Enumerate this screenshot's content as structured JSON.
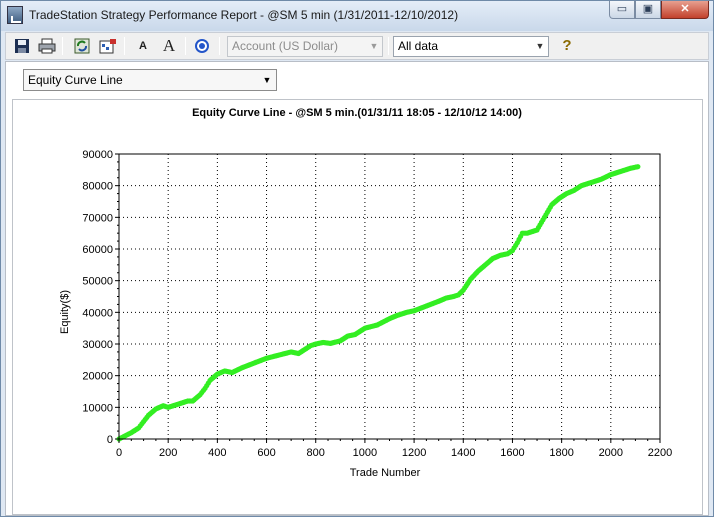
{
  "window": {
    "title": "TradeStation Strategy Performance Report - @SM 5 min (1/31/2011-12/10/2012)",
    "minimize_glyph": "▭",
    "maximize_glyph": "▣",
    "close_glyph": "✕"
  },
  "toolbar": {
    "save_icon": "save-icon",
    "print_icon": "print-icon",
    "refresh_icon": "refresh-icon",
    "settings_icon": "settings-icon",
    "font_small_label": "A",
    "font_large_label": "A",
    "target_icon": "target-icon",
    "account_combo": "Account (US Dollar)",
    "period_combo": "All data",
    "help_label": "?"
  },
  "view_selector": "Equity Curve Line",
  "chart_data": {
    "type": "line",
    "title": "Equity Curve Line - @SM 5 min.(01/31/11 18:05 - 12/10/12 14:00)",
    "xlabel": "Trade Number",
    "ylabel": "Equity($)",
    "xlim": [
      0,
      2200
    ],
    "ylim": [
      0,
      90000
    ],
    "x_ticks": [
      "0",
      "200",
      "400",
      "600",
      "800",
      "1000",
      "1200",
      "1400",
      "1600",
      "1800",
      "2000",
      "2200"
    ],
    "y_ticks": [
      "0",
      "10000",
      "20000",
      "30000",
      "40000",
      "50000",
      "60000",
      "70000",
      "80000",
      "90000"
    ],
    "grid": true,
    "series_color": "#33ee22",
    "drawdown_color": "#000000",
    "series": [
      {
        "x": [
          0,
          20,
          50,
          80,
          100,
          120,
          150,
          180,
          200,
          240,
          280,
          300,
          330,
          350,
          370,
          400,
          430,
          460,
          500,
          550,
          600,
          650,
          700,
          730,
          760,
          780,
          800,
          830,
          860,
          900,
          930,
          960,
          1000,
          1050,
          1100,
          1130,
          1170,
          1200,
          1250,
          1300,
          1330,
          1360,
          1380,
          1400,
          1430,
          1460,
          1490,
          1520,
          1550,
          1580,
          1600,
          1620,
          1640,
          1660,
          1700,
          1730,
          1760,
          1790,
          1820,
          1850,
          1880,
          1920,
          1960,
          2000,
          2040,
          2080,
          2110
        ],
        "y": [
          0,
          800,
          2000,
          3500,
          5500,
          7500,
          9500,
          10500,
          10000,
          11000,
          12000,
          12000,
          14000,
          16000,
          18500,
          20500,
          21500,
          21000,
          22500,
          24000,
          25500,
          26500,
          27500,
          27000,
          28500,
          29500,
          30000,
          30500,
          30200,
          31000,
          32500,
          33000,
          35000,
          36000,
          38000,
          39000,
          40000,
          40500,
          42000,
          43500,
          44500,
          45000,
          45500,
          47000,
          50500,
          53000,
          55000,
          57000,
          58000,
          58500,
          59500,
          62000,
          65000,
          65000,
          66000,
          70000,
          74000,
          76000,
          77500,
          78500,
          80000,
          81000,
          82000,
          83500,
          84500,
          85500,
          86000
        ]
      }
    ]
  }
}
